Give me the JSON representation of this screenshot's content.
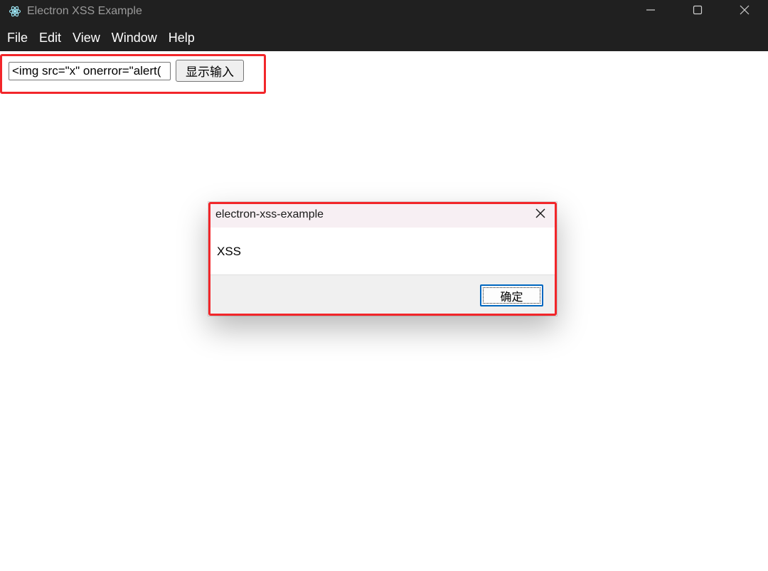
{
  "window": {
    "title": "Electron XSS Example",
    "app_icon": "electron-icon",
    "controls": [
      "minimize-icon",
      "maximize-icon",
      "close-icon"
    ]
  },
  "menu": {
    "items": [
      {
        "label": "File"
      },
      {
        "label": "Edit"
      },
      {
        "label": "View"
      },
      {
        "label": "Window"
      },
      {
        "label": "Help"
      }
    ]
  },
  "form": {
    "input_value": "<img src=\"x\" onerror=\"alert(",
    "button_label": "显示输入"
  },
  "dialog": {
    "title": "electron-xss-example",
    "message": "XSS",
    "ok_label": "确定",
    "close_icon": "close-icon"
  },
  "colors": {
    "titlebar_bg": "#202020",
    "highlight": "#f2262a",
    "dialog_title_bg": "#f7eff3",
    "dialog_footer_bg": "#f0f0f0",
    "focus_border": "#0067c0"
  }
}
